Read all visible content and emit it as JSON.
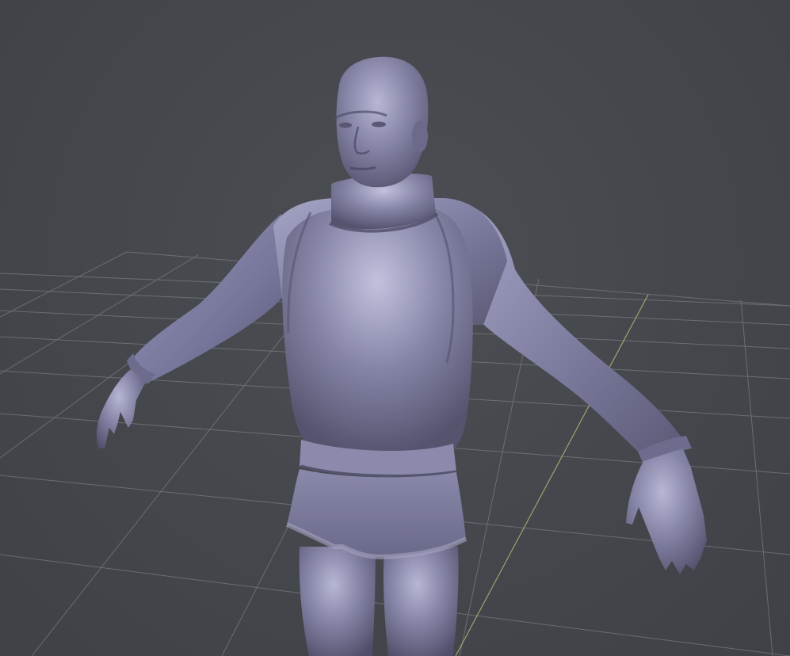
{
  "viewport": {
    "background_color": "#43464b",
    "grid_color": "#8a8f92",
    "axis_z_color": "#b9c47a",
    "model_color": "#7d7c9c",
    "model_highlight_color": "#b7b6d4",
    "model_shadow_color": "#4f4e69",
    "grid_visible": true
  }
}
